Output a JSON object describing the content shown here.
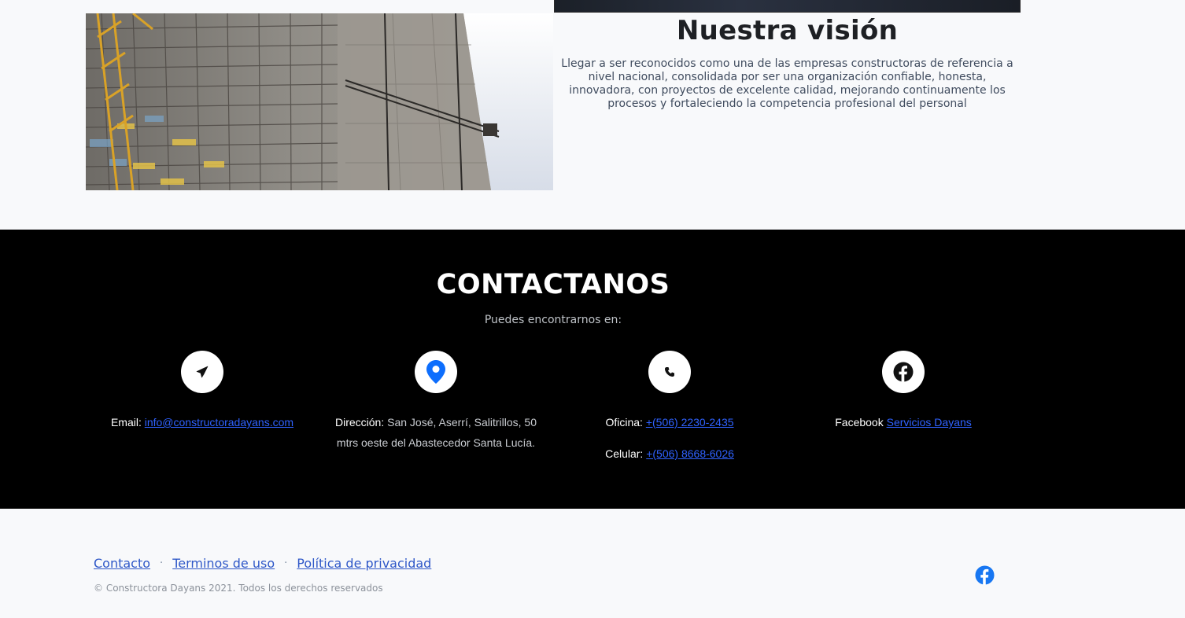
{
  "vision": {
    "title": "Nuestra visión",
    "body": "Llegar a ser reconocidos como una de las empresas constructoras de referencia a nivel nacional, consolidada por ser una organización confiable, honesta, innovadora, con proyectos de excelente calidad, mejorando continuamente los procesos y fortaleciendo la competencia profesional del personal"
  },
  "contact": {
    "title": "CONTACTANOS",
    "subtitle": "Puedes encontrarnos en:",
    "email": {
      "icon": "paper-plane-icon",
      "label": "Email:",
      "value": "info@constructoradayans.com"
    },
    "address": {
      "icon": "map-marker-icon",
      "label": "Dirección:",
      "value": "San José, Aserrí, Salitrillos, 50 mtrs oeste del Abastecedor Santa Lucía."
    },
    "phone": {
      "icon": "phone-icon",
      "office_label": "Oficina:",
      "office_value": "+(506) 2230-2435",
      "mobile_label": "Celular:",
      "mobile_value": "+(506) 8668-6026"
    },
    "facebook": {
      "icon": "facebook-icon",
      "label": "Facebook",
      "value": "Servicios Dayans"
    }
  },
  "footer": {
    "links": [
      "Contacto",
      "Terminos de uso",
      "Política de privacidad"
    ],
    "separator": "·",
    "copyright": "© Constructora Dayans 2021. Todos los derechos reservados",
    "social_icon": "facebook-icon"
  },
  "colors": {
    "contact_bg": "#000000",
    "link": "#2f62ff",
    "marker_blue": "#0d6efd",
    "facebook_blue": "#1877f2"
  }
}
